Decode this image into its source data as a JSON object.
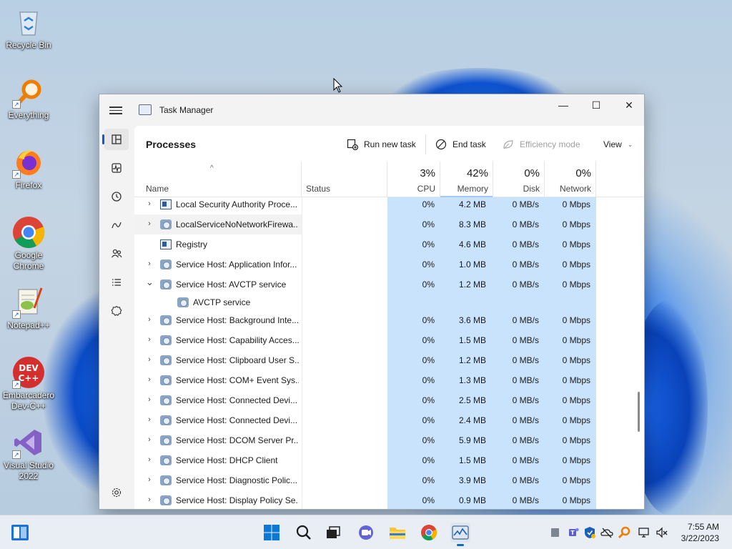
{
  "desktop": {
    "icons": [
      {
        "label": "Recycle Bin"
      },
      {
        "label": "Everything"
      },
      {
        "label": "Firefox"
      },
      {
        "label": "Google Chrome"
      },
      {
        "label": "Notepad++"
      },
      {
        "label": "Embarcadero Dev-C++"
      },
      {
        "label": "Visual Studio 2022"
      }
    ]
  },
  "window": {
    "title": "Task Manager",
    "controls": {
      "minimize": "—",
      "maximize": "☐",
      "close": "✕"
    }
  },
  "toolbar": {
    "page_title": "Processes",
    "run_new_task": "Run new task",
    "end_task": "End task",
    "efficiency_mode": "Efficiency mode",
    "view": "View"
  },
  "table": {
    "headers": {
      "name": "Name",
      "status": "Status",
      "cpu": {
        "pct": "3%",
        "label": "CPU"
      },
      "memory": {
        "pct": "42%",
        "label": "Memory"
      },
      "disk": {
        "pct": "0%",
        "label": "Disk"
      },
      "network": {
        "pct": "0%",
        "label": "Network"
      }
    },
    "rows": [
      {
        "name": "Local Security Authority Proce...",
        "cpu": "0%",
        "memory": "4.2 MB",
        "disk": "0 MB/s",
        "network": "0 Mbps"
      },
      {
        "name": "LocalServiceNoNetworkFirewa...",
        "cpu": "0%",
        "memory": "8.3 MB",
        "disk": "0 MB/s",
        "network": "0 Mbps"
      },
      {
        "name": "Registry",
        "cpu": "0%",
        "memory": "4.6 MB",
        "disk": "0 MB/s",
        "network": "0 Mbps"
      },
      {
        "name": "Service Host: Application Infor...",
        "cpu": "0%",
        "memory": "1.0 MB",
        "disk": "0 MB/s",
        "network": "0 Mbps"
      },
      {
        "name": "Service Host: AVCTP service",
        "cpu": "0%",
        "memory": "1.2 MB",
        "disk": "0 MB/s",
        "network": "0 Mbps"
      },
      {
        "name": "AVCTP service"
      },
      {
        "name": "Service Host: Background Inte...",
        "cpu": "0%",
        "memory": "3.6 MB",
        "disk": "0 MB/s",
        "network": "0 Mbps"
      },
      {
        "name": "Service Host: Capability Acces...",
        "cpu": "0%",
        "memory": "1.5 MB",
        "disk": "0 MB/s",
        "network": "0 Mbps"
      },
      {
        "name": "Service Host: Clipboard User S...",
        "cpu": "0%",
        "memory": "1.2 MB",
        "disk": "0 MB/s",
        "network": "0 Mbps"
      },
      {
        "name": "Service Host: COM+ Event Sys...",
        "cpu": "0%",
        "memory": "1.3 MB",
        "disk": "0 MB/s",
        "network": "0 Mbps"
      },
      {
        "name": "Service Host: Connected Devi...",
        "cpu": "0%",
        "memory": "2.5 MB",
        "disk": "0 MB/s",
        "network": "0 Mbps"
      },
      {
        "name": "Service Host: Connected Devi...",
        "cpu": "0%",
        "memory": "2.4 MB",
        "disk": "0 MB/s",
        "network": "0 Mbps"
      },
      {
        "name": "Service Host: DCOM Server Pr...",
        "cpu": "0%",
        "memory": "5.9 MB",
        "disk": "0 MB/s",
        "network": "0 Mbps"
      },
      {
        "name": "Service Host: DHCP Client",
        "cpu": "0%",
        "memory": "1.5 MB",
        "disk": "0 MB/s",
        "network": "0 Mbps"
      },
      {
        "name": "Service Host: Diagnostic Polic...",
        "cpu": "0%",
        "memory": "3.9 MB",
        "disk": "0 MB/s",
        "network": "0 Mbps"
      },
      {
        "name": "Service Host: Display Policy Se...",
        "cpu": "0%",
        "memory": "0.9 MB",
        "disk": "0 MB/s",
        "network": "0 Mbps"
      }
    ]
  },
  "taskbar": {
    "time": "7:55 AM",
    "date": "3/22/2023"
  }
}
